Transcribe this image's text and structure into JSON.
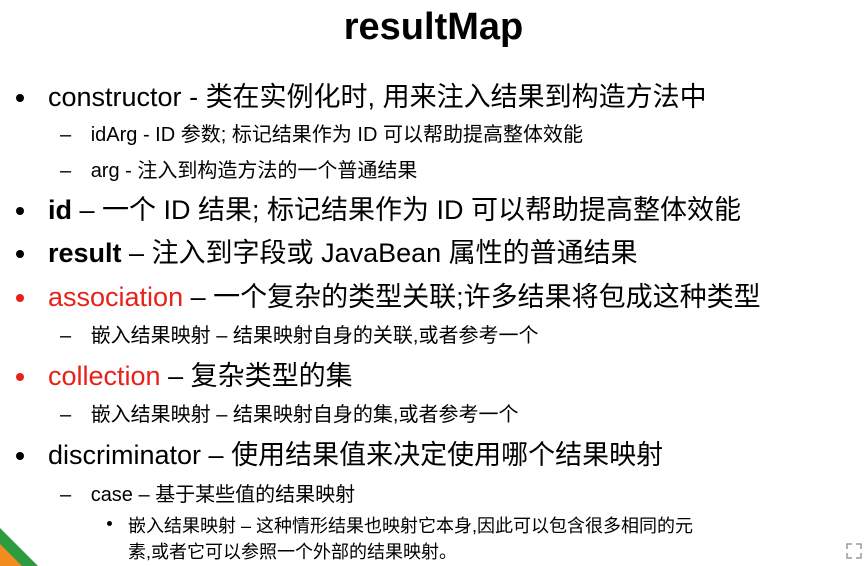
{
  "title": "resultMap",
  "items": [
    {
      "term": "constructor",
      "sep": " - ",
      "desc": "类在实例化时, 用来注入结果到构造方法中"
    },
    {
      "term": "idArg",
      "sep": " - ",
      "desc": "ID 参数; 标记结果作为 ID 可以帮助提高整体效能"
    },
    {
      "term": "arg",
      "sep": " - ",
      "desc": "注入到构造方法的一个普通结果"
    },
    {
      "term": "id",
      "sep": " – ",
      "desc": "一个 ID 结果; 标记结果作为 ID 可以帮助提高整体效能"
    },
    {
      "term": "result",
      "sep": " – ",
      "desc": "注入到字段或 JavaBean 属性的普通结果"
    },
    {
      "term": "association",
      "sep": " – ",
      "desc": "一个复杂的类型关联;许多结果将包成这种类型"
    },
    {
      "text": "嵌入结果映射 – 结果映射自身的关联,或者参考一个"
    },
    {
      "term": "collection",
      "sep": " – ",
      "desc": "复杂类型的集"
    },
    {
      "text": "嵌入结果映射 – 结果映射自身的集,或者参考一个"
    },
    {
      "term": "discriminator",
      "sep": " – ",
      "desc": "使用结果值来决定使用哪个结果映射"
    },
    {
      "term": "case",
      "sep": " – ",
      "desc": "基于某些值的结果映射"
    },
    {
      "line1": "嵌入结果映射 – 这种情形结果也映射它本身,因此可以包含很多相同的元",
      "line2": "素,或者它可以参照一个外部的结果映射。"
    }
  ],
  "colors": {
    "accent_red": "#e8201a",
    "deco_green": "#2e9b3e",
    "deco_orange": "#f28c1f"
  },
  "icons": {
    "corner": "expand-icon"
  }
}
